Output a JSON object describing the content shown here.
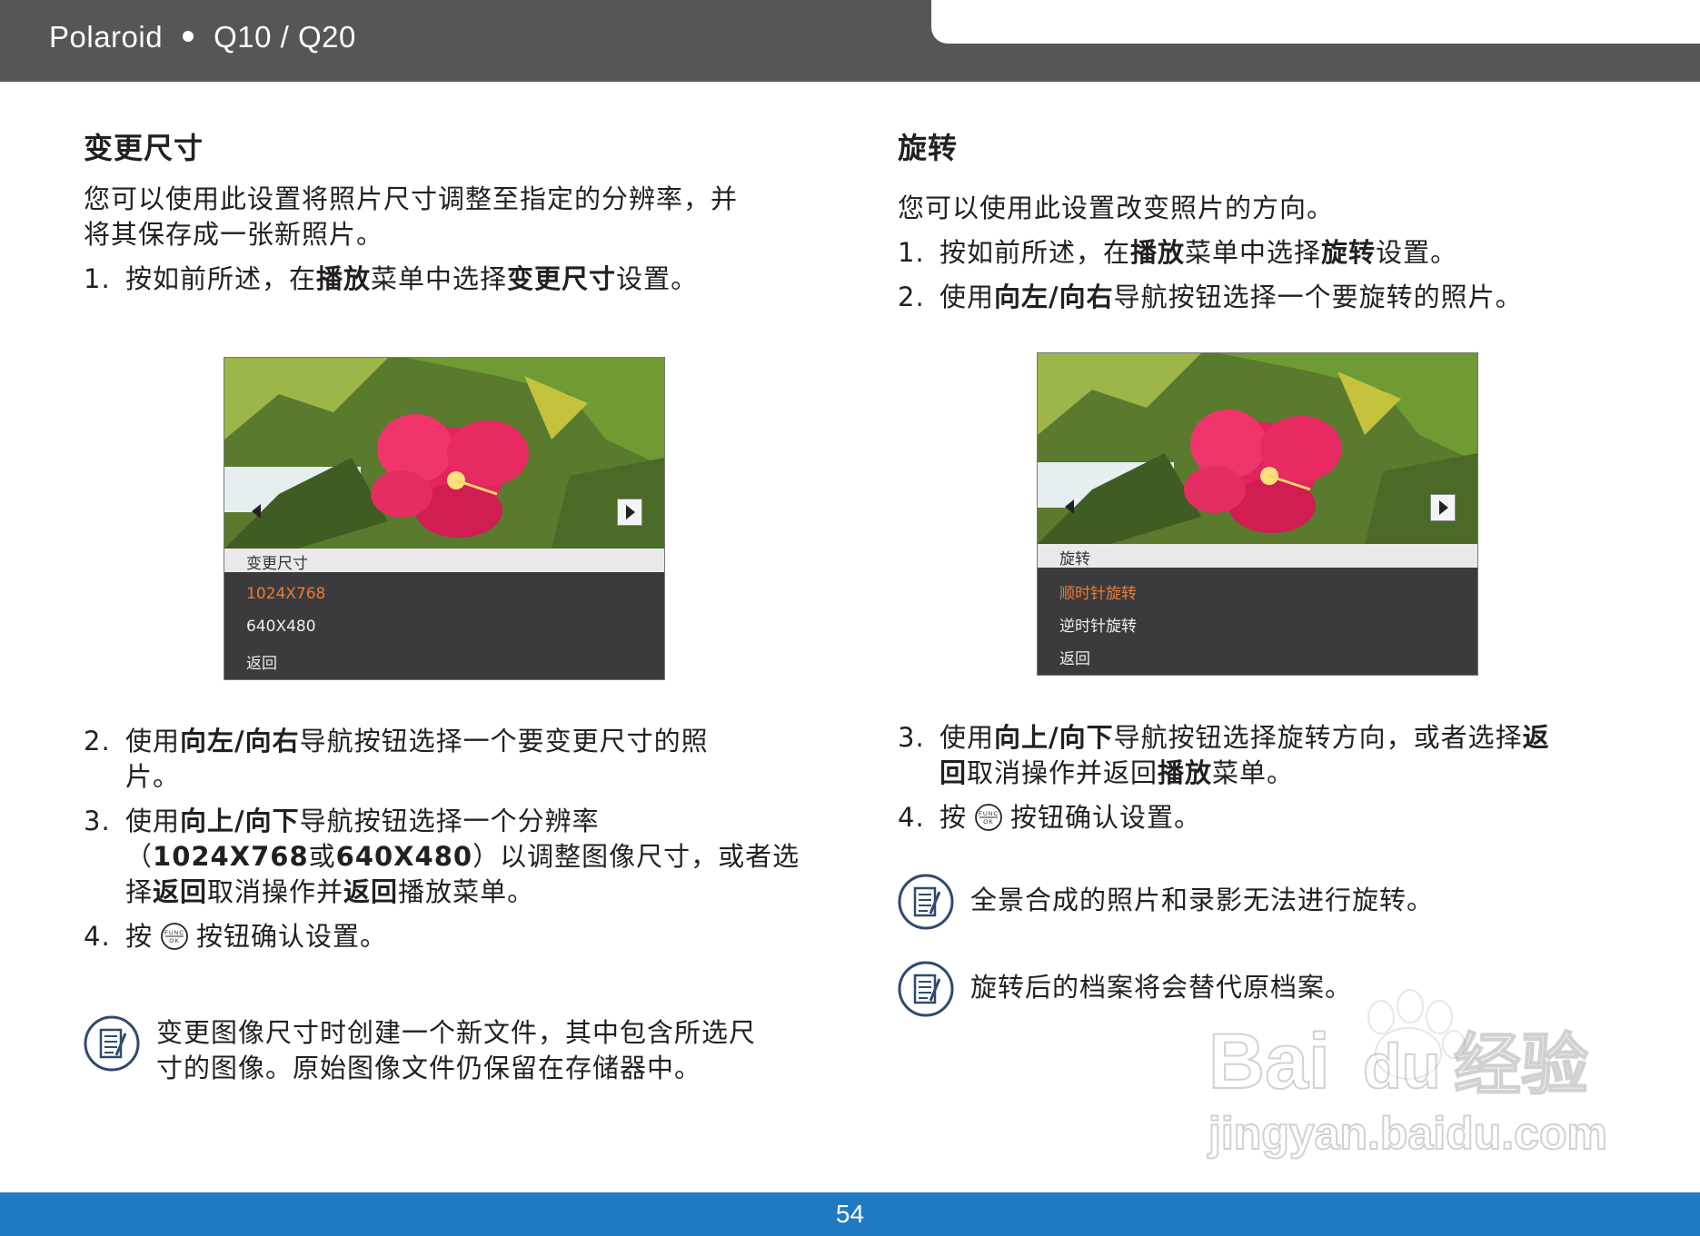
{
  "header": {
    "brand": "Polaroid",
    "model": "Q10 / Q20"
  },
  "footer": {
    "page_number": "54"
  },
  "left": {
    "title": "变更尺寸",
    "intro_line1": "您可以使用此设置将照片尺寸调整至指定的分辨率，并",
    "intro_line2": "将其保存成一张新照片。",
    "step1": {
      "num": "1.",
      "a": "按如前所述，在",
      "b1": "播放",
      "c": "菜单中选择",
      "b2": "变更尺寸",
      "d": "设置。"
    },
    "screen": {
      "menu_title": "变更尺寸",
      "items": [
        "1024X768",
        "640X480",
        "返回"
      ]
    },
    "step2": {
      "num": "2.",
      "a": "使用",
      "b1": "向左/向右",
      "c": "导航按钮选择一个要变更尺寸的照",
      "d": "片。"
    },
    "step3": {
      "num": "3.",
      "a": "使用",
      "b1": "向上/向下",
      "c": "导航按钮选择一个分辨率",
      "d": "（",
      "b2": "1024X768",
      "e": "或",
      "b3": "640X480",
      "f": "）以调整图像尺寸，或者选",
      "g": "择",
      "b4": "返回",
      "h": "取消操作并",
      "b5": "返回",
      "i": "播放菜单。"
    },
    "step4": {
      "num": "4.",
      "a": "按",
      "b": "按钮确认设置。"
    },
    "note_line1": "变更图像尺寸时创建一个新文件，其中包含所选尺",
    "note_line2": "寸的图像。原始图像文件仍保留在存储器中。"
  },
  "right": {
    "title": "旋转",
    "intro": "您可以使用此设置改变照片的方向。",
    "step1": {
      "num": "1.",
      "a": "按如前所述，在",
      "b1": "播放",
      "c": "菜单中选择",
      "b2": "旋转",
      "d": "设置。"
    },
    "step2": {
      "num": "2.",
      "a": "使用",
      "b1": "向左/向右",
      "c": "导航按钮选择一个要旋转的照片。"
    },
    "screen": {
      "menu_title": "旋转",
      "items": [
        "顺时针旋转",
        "逆时针旋转",
        "返回"
      ]
    },
    "step3": {
      "num": "3.",
      "a": "使用",
      "b1": "向上/向下",
      "c": "导航按钮选择旋转方向，或者选择",
      "b2": "返",
      "b3": "回",
      "d": "取消操作并返回",
      "b4": "播放",
      "e": "菜单。"
    },
    "step4": {
      "num": "4.",
      "a": "按",
      "b": "按钮确认设置。"
    },
    "note1": "全景合成的照片和录影无法进行旋转。",
    "note2": "旋转后的档案将会替代原档案。"
  },
  "func_icon": {
    "top": "FUNC",
    "bottom": "OK"
  },
  "watermark": {
    "brand_a": "Bai",
    "brand_b": "du",
    "brand_c": "经验",
    "url": "jingyan.baidu.com"
  },
  "colors": {
    "header": "#565659",
    "footer": "#1f7ac2",
    "selected_menu": "#f07a32",
    "note_icon": "#2f4a6e"
  }
}
